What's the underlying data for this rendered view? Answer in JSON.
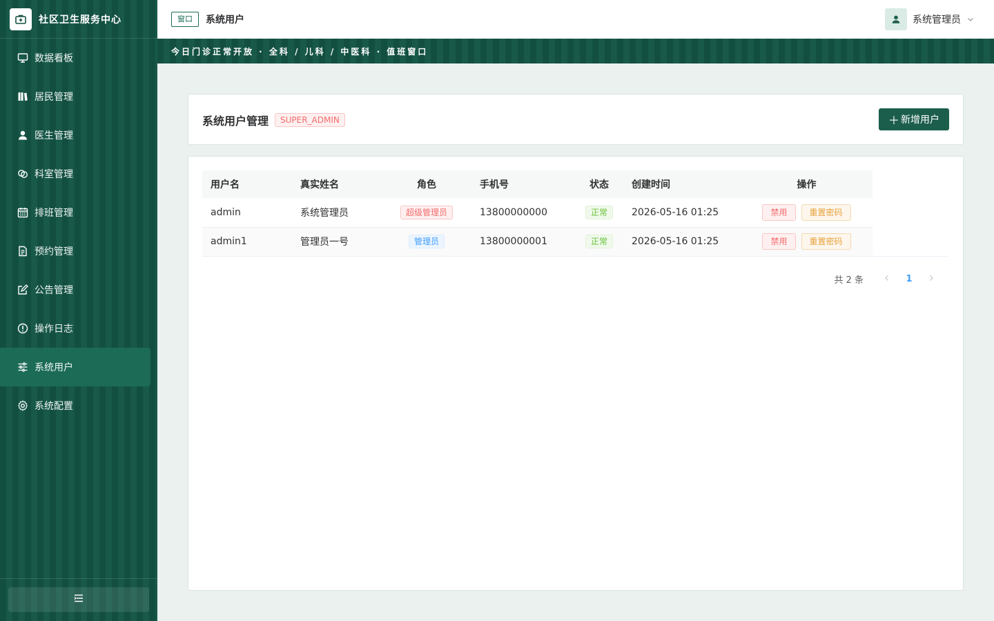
{
  "app": {
    "title": "社区卫生服务中心",
    "logo_icon": "medical-kit-icon"
  },
  "sidebar": {
    "items": [
      {
        "label": "数据看板",
        "icon": "monitor-icon",
        "active": false
      },
      {
        "label": "居民管理",
        "icon": "files-icon",
        "active": false
      },
      {
        "label": "医生管理",
        "icon": "user-icon",
        "active": false
      },
      {
        "label": "科室管理",
        "icon": "link-icon",
        "active": false
      },
      {
        "label": "排班管理",
        "icon": "calendar-icon",
        "active": false
      },
      {
        "label": "预约管理",
        "icon": "document-icon",
        "active": false
      },
      {
        "label": "公告管理",
        "icon": "edit-icon",
        "active": false
      },
      {
        "label": "操作日志",
        "icon": "warning-icon",
        "active": false
      },
      {
        "label": "系统用户",
        "icon": "sliders-icon",
        "active": true
      },
      {
        "label": "系统配置",
        "icon": "gear-icon",
        "active": false
      }
    ],
    "collapse_icon": "fold-icon"
  },
  "header": {
    "window_tag": "窗口",
    "page_title": "系统用户",
    "user_name": "系统管理员"
  },
  "banner": {
    "text": "今日门诊正常开放 · 全科 / 儿科 / 中医科 · 值班窗口"
  },
  "panel": {
    "title": "系统用户管理",
    "role_tag": "SUPER_ADMIN",
    "add_button": "新增用户"
  },
  "table": {
    "columns": [
      "用户名",
      "真实姓名",
      "角色",
      "手机号",
      "状态",
      "创建时间",
      "操作"
    ],
    "rows": [
      {
        "username": "admin",
        "real_name": "系统管理员",
        "role": "超级管理员",
        "phone": "13800000000",
        "status": "正常",
        "created": "2026-05-16 01:25",
        "action_disable": "禁用",
        "action_reset": "重置密码"
      },
      {
        "username": "admin1",
        "real_name": "管理员一号",
        "role": "管理员",
        "phone": "13800000001",
        "status": "正常",
        "created": "2026-05-16 01:25",
        "action_disable": "禁用",
        "action_reset": "重置密码"
      }
    ]
  },
  "pagination": {
    "total": "共 2 条",
    "current": "1"
  },
  "colors": {
    "sidebar_green": "#134f41",
    "accent": "#1c5e4c",
    "active_item": "#1c6b57",
    "page_bg": "#eaf1ee"
  }
}
